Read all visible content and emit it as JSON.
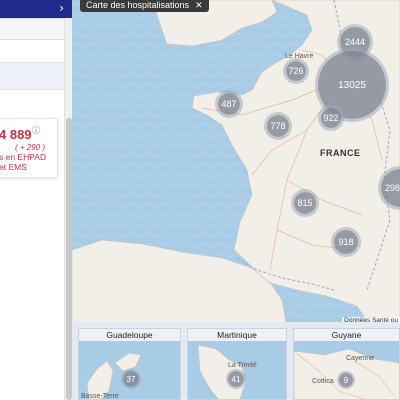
{
  "left_panel": {
    "stat": {
      "value": "4 889",
      "info_symbol": "ⓘ",
      "delta": "( + 290 )",
      "label_line1": "s en EHPAD",
      "label_line2": "et EMS"
    },
    "expand_chevron": "›"
  },
  "map": {
    "title": "Carte des hospitalisations",
    "close_symbol": "✕",
    "country_label": "FRANCE",
    "place_labels": [
      "Le Havre"
    ],
    "attribution": "Données Santé pu",
    "clusters": [
      {
        "id": "cluster-2444",
        "label": "2444"
      },
      {
        "id": "cluster-726",
        "label": "726"
      },
      {
        "id": "cluster-13025",
        "label": "13025"
      },
      {
        "id": "cluster-487",
        "label": "487"
      },
      {
        "id": "cluster-778",
        "label": "778"
      },
      {
        "id": "cluster-922",
        "label": "922"
      },
      {
        "id": "cluster-298",
        "label": "298"
      },
      {
        "id": "cluster-815",
        "label": "815"
      },
      {
        "id": "cluster-918",
        "label": "918"
      }
    ]
  },
  "insets": [
    {
      "title": "Guadeloupe",
      "places": [
        "Basse-Terre"
      ],
      "cluster": "37"
    },
    {
      "title": "Martinique",
      "places": [
        "La Trinité"
      ],
      "cluster": "41"
    },
    {
      "title": "Guyane",
      "places": [
        "Cayenne",
        "Cottica"
      ],
      "cluster": "9"
    }
  ]
}
